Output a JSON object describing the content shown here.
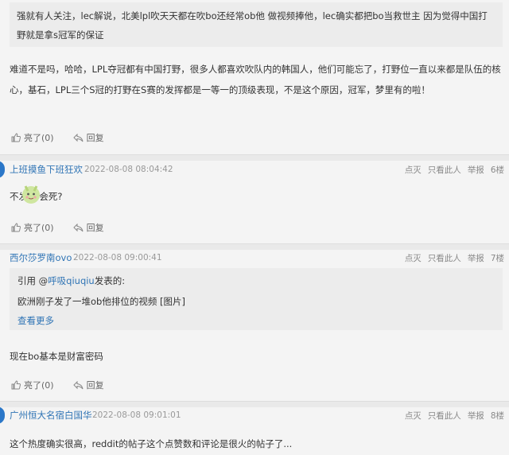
{
  "top_quote": {
    "text": "强就有人关注，lec解说，北美lpl吹天天都在吹bo还经常ob他 做视频捧他，lec确实都把bo当救世主 因为觉得中国打野就是拿s冠军的保证"
  },
  "body_paragraph": {
    "text": "难道不是吗，哈哈，LPL夺冠都有中国打野，很多人都喜欢吹队内的韩国人，他们可能忘了，打野位一直以来都是队伍的核心，基石，LPL三个S冠的打野在S赛的发挥都是一等一的顶级表现，不是这个原因，冠军，梦里有的啦！"
  },
  "actions": {
    "like": "亮了(0)",
    "reply": "回复"
  },
  "posts": [
    {
      "username": "上班摸鱼下班狂欢",
      "date": "2022-08-08 08:04:42",
      "ops": {
        "diss": "点灭",
        "only": "只看此人",
        "report": "举报",
        "floor": "6楼"
      },
      "content": "不发bo会死?"
    },
    {
      "username": "西尔莎罗南ovo",
      "date": "2022-08-08 09:00:41",
      "ops": {
        "diss": "点灭",
        "only": "只看此人",
        "report": "举报",
        "floor": "7楼"
      },
      "quote": {
        "prefix": "引用 @",
        "name": "呼吸qiuqiu",
        "suffix": "发表的:",
        "text": "欧洲刚子发了一堆ob他排位的视频 [图片]",
        "more": "查看更多"
      },
      "content": "现在bo基本是财富密码"
    },
    {
      "username": "广州恒大名宿白国华",
      "date": "2022-08-08 09:01:01",
      "ops": {
        "diss": "点灭",
        "only": "只看此人",
        "report": "举报",
        "floor": "8楼"
      },
      "content": "这个热度确实很高，reddit的帖子这个点赞数和评论是很火的帖子了..."
    }
  ],
  "colors": {
    "link": "#2f74b5",
    "text": "#333333",
    "muted": "#999999",
    "quote_bg": "#ececec"
  },
  "icons": [
    "thumbs-up-icon",
    "reply-icon",
    "avatar-icon",
    "sticker-icon"
  ]
}
